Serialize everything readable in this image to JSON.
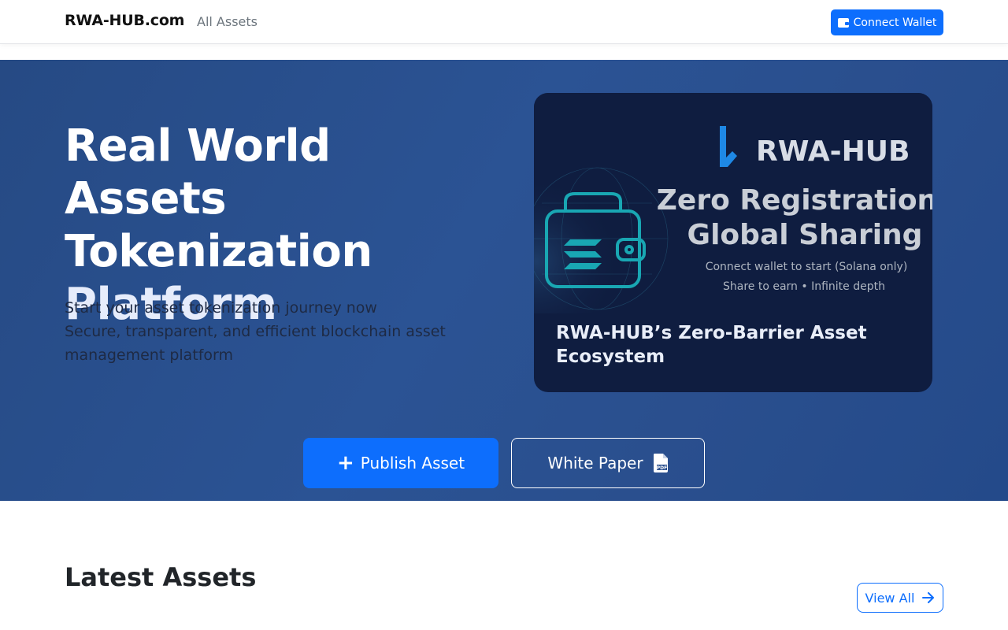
{
  "navbar": {
    "brand": "RWA-HUB.com",
    "links": [
      {
        "label": "All Assets"
      }
    ],
    "connect_wallet": {
      "label": "Connect Wallet",
      "icon": "wallet-icon"
    }
  },
  "hero": {
    "title_lines": [
      "Real World Assets",
      "Tokenization",
      "Platform"
    ],
    "subtitle_lines": [
      "Start your asset tokenization journey now",
      "Secure, transparent, and efficient blockchain asset",
      "management platform"
    ],
    "feature_card": {
      "image": {
        "logo_text": "RWA-HUB",
        "headline_lines": [
          "Zero Registration",
          "Global Sharing"
        ],
        "tagline_lines": [
          "Connect wallet to start (Solana only)",
          "Share to earn • Infinite depth"
        ]
      },
      "caption_lines": [
        "RWA-HUB’s Zero-Barrier Asset",
        "Ecosystem"
      ]
    },
    "publish_button": {
      "label": "Publish Asset",
      "icon": "plus-icon"
    },
    "white_paper_button": {
      "label": "White Paper",
      "icon": "pdf-file-icon"
    }
  },
  "latest": {
    "title": "Latest Assets",
    "view_all": {
      "label": "View All",
      "icon": "arrow-right-icon"
    }
  },
  "colors": {
    "primary": "#0d6efd",
    "hero_bg": "#2a4f8e",
    "card_bg": "#0f1d40",
    "teal_accent": "#17a2b8"
  }
}
